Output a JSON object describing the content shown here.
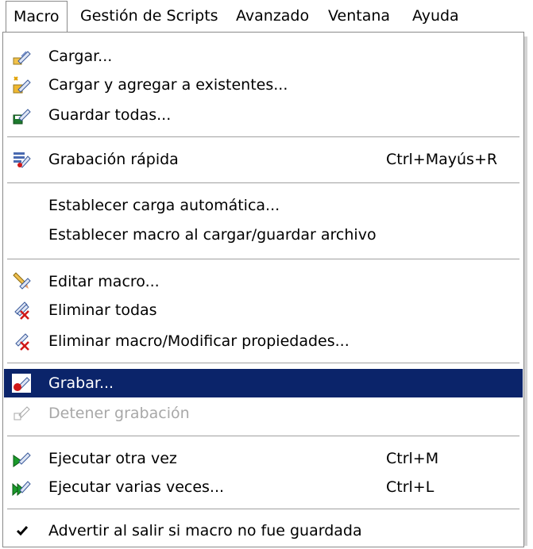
{
  "menubar": {
    "items": [
      "Macro",
      "Gestión de Scripts",
      "Avanzado",
      "Ventana",
      "Ayuda"
    ]
  },
  "menu": {
    "items": [
      {
        "label": "Cargar...",
        "icon": "load-macro-icon"
      },
      {
        "label": "Cargar y agregar a existentes...",
        "icon": "load-add-macro-icon"
      },
      {
        "label": "Guardar todas...",
        "icon": "save-macro-icon"
      },
      {
        "label": "Grabación rápida",
        "shortcut": "Ctrl+Mayús+R",
        "icon": "quick-record-icon"
      },
      {
        "label": "Establecer carga automática..."
      },
      {
        "label": "Establecer macro al cargar/guardar archivo"
      },
      {
        "label": "Editar macro...",
        "icon": "edit-macro-icon"
      },
      {
        "label": "Eliminar todas",
        "icon": "delete-all-icon"
      },
      {
        "label": "Eliminar macro/Modificar propiedades...",
        "icon": "delete-macro-icon"
      },
      {
        "label": "Grabar...",
        "icon": "record-icon",
        "state": "highlighted"
      },
      {
        "label": "Detener grabación",
        "icon": "stop-record-icon",
        "state": "disabled"
      },
      {
        "label": "Ejecutar otra vez",
        "shortcut": "Ctrl+M",
        "icon": "run-again-icon"
      },
      {
        "label": "Ejecutar varias veces...",
        "shortcut": "Ctrl+L",
        "icon": "run-multiple-icon"
      },
      {
        "label": "Advertir al salir si macro no fue guardada",
        "checked": true
      }
    ]
  },
  "colors": {
    "highlight": "#0b246a",
    "disabled_text": "#a8a8a8",
    "separator": "#a0a0a0"
  }
}
